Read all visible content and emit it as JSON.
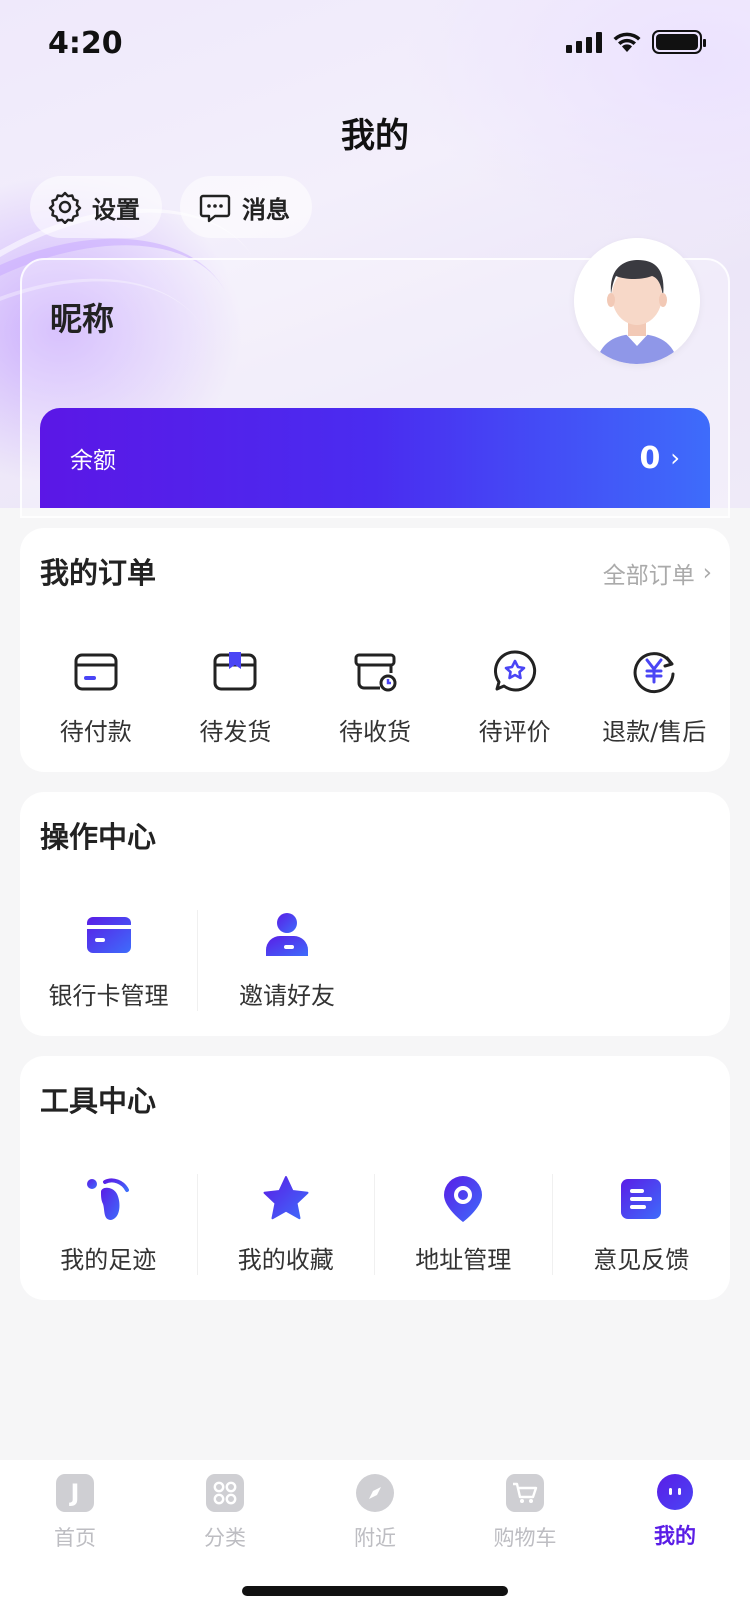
{
  "status_bar": {
    "time": "4:20"
  },
  "header": {
    "title": "我的"
  },
  "quick": {
    "settings": "设置",
    "messages": "消息"
  },
  "profile": {
    "nickname": "昵称",
    "balance_label": "余额",
    "balance_value": "0"
  },
  "orders": {
    "title": "我的订单",
    "more": "全部订单",
    "items": [
      {
        "label": "待付款",
        "icon": "wallet-icon"
      },
      {
        "label": "待发货",
        "icon": "package-icon"
      },
      {
        "label": "待收货",
        "icon": "delivery-box-icon"
      },
      {
        "label": "待评价",
        "icon": "review-chat-icon"
      },
      {
        "label": "退款/售后",
        "icon": "refund-yen-icon"
      }
    ]
  },
  "operations": {
    "title": "操作中心",
    "items": [
      {
        "label": "银行卡管理",
        "icon": "bank-card-icon"
      },
      {
        "label": "邀请好友",
        "icon": "invite-user-icon"
      }
    ]
  },
  "tools": {
    "title": "工具中心",
    "items": [
      {
        "label": "我的足迹",
        "icon": "footprint-icon"
      },
      {
        "label": "我的收藏",
        "icon": "star-icon"
      },
      {
        "label": "地址管理",
        "icon": "location-pin-icon"
      },
      {
        "label": "意见反馈",
        "icon": "feedback-note-icon"
      }
    ]
  },
  "tabbar": {
    "items": [
      {
        "label": "首页",
        "icon": "home-icon"
      },
      {
        "label": "分类",
        "icon": "category-grid-icon"
      },
      {
        "label": "附近",
        "icon": "compass-icon"
      },
      {
        "label": "购物车",
        "icon": "cart-icon"
      },
      {
        "label": "我的",
        "icon": "profile-face-icon",
        "active": true
      }
    ]
  },
  "colors": {
    "accent": "#5A1DE6",
    "accent_blue": "#3E6CFB",
    "inactive": "#BDBDC2"
  }
}
